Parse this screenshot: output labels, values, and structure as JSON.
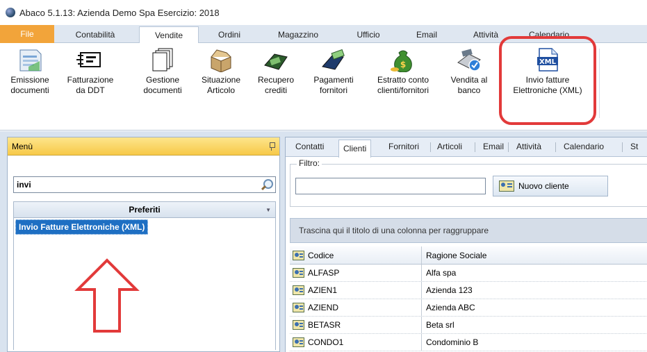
{
  "window": {
    "title": "Abaco 5.1.13: Azienda Demo Spa Esercizio: 2018"
  },
  "ribbon": {
    "tabs": [
      {
        "label": "File"
      },
      {
        "label": "Contabilità"
      },
      {
        "label": "Vendite"
      },
      {
        "label": "Ordini"
      },
      {
        "label": "Magazzino"
      },
      {
        "label": "Ufficio"
      },
      {
        "label": "Email"
      },
      {
        "label": "Attività"
      },
      {
        "label": "Calendario"
      }
    ],
    "buttons": [
      {
        "label": "Emissione\ndocumenti",
        "icon": "document-emission-icon"
      },
      {
        "label": "Fatturazione\nda DDT",
        "icon": "invoice-ddt-icon"
      },
      {
        "label": "Gestione\ndocumenti",
        "icon": "documents-stack-icon"
      },
      {
        "label": "Situazione\nArticolo",
        "icon": "open-box-icon"
      },
      {
        "label": "Recupero\ncrediti",
        "icon": "money-recovery-icon"
      },
      {
        "label": "Pagamenti\nfornitori",
        "icon": "supplier-payment-icon"
      },
      {
        "label": "Estratto conto\nclienti/fornitori",
        "icon": "money-bag-icon"
      },
      {
        "label": "Vendita al\nbanco",
        "icon": "cash-register-icon"
      },
      {
        "label": "Invio fatture\nElettroniche (XML)",
        "icon": "xml-file-icon",
        "icon_text": "XML"
      }
    ]
  },
  "menu": {
    "title": "Menù",
    "search_value": "invi",
    "group": "Preferiti",
    "selected_item": "Invio Fatture Elettroniche (XML)"
  },
  "contacts": {
    "tabs": [
      "Contatti",
      "Clienti",
      "Fornitori",
      "Articoli",
      "Email",
      "Attività",
      "Calendario",
      "St"
    ],
    "filter_label": "Filtro:",
    "filter_value": "",
    "new_button": "Nuovo cliente",
    "group_hint": "Trascina qui il titolo di una colonna per raggruppare",
    "columns": {
      "code": "Codice",
      "name": "Ragione Sociale"
    },
    "rows": [
      {
        "code": "ALFASP",
        "name": "Alfa spa"
      },
      {
        "code": "AZIEN1",
        "name": "Azienda 123"
      },
      {
        "code": "AZIEND",
        "name": "Azienda ABC"
      },
      {
        "code": "BETASR",
        "name": "Beta srl"
      },
      {
        "code": "CONDO1",
        "name": "Condominio B"
      }
    ]
  },
  "colors": {
    "accent": "#1e6fc3",
    "file_tab": "#f2a43a",
    "highlight": "#e23a3a"
  }
}
